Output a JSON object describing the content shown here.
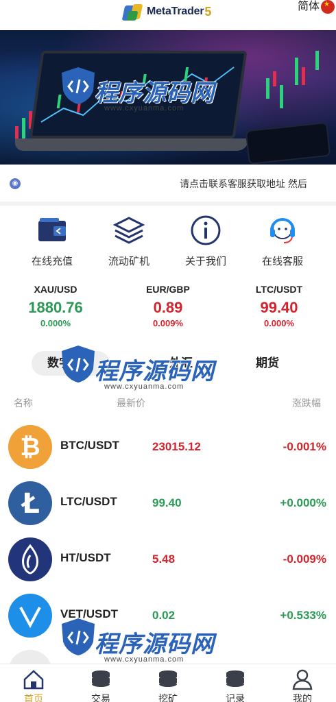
{
  "header": {
    "logo_text": "MetaTrader",
    "logo_version": "5",
    "language": "简体"
  },
  "notice": {
    "text": "请点击联系客服获取地址 然后"
  },
  "quick_actions": [
    {
      "label": "在线充值",
      "icon": "wallet-icon"
    },
    {
      "label": "流动矿机",
      "icon": "layers-icon"
    },
    {
      "label": "关于我们",
      "icon": "info-icon"
    },
    {
      "label": "在线客服",
      "icon": "headset-icon"
    }
  ],
  "tickers": [
    {
      "symbol": "XAU/USD",
      "price": "1880.76",
      "change": "0.000%",
      "color": "#2b9a55"
    },
    {
      "symbol": "EUR/GBP",
      "price": "0.89",
      "change": "0.009%",
      "color": "#d3232d"
    },
    {
      "symbol": "LTC/USDT",
      "price": "99.40",
      "change": "0.000%",
      "color": "#d3232d"
    }
  ],
  "tabs": [
    {
      "label": "数字货币",
      "active": true
    },
    {
      "label": "外汇",
      "active": false
    },
    {
      "label": "期货",
      "active": false
    }
  ],
  "table": {
    "headers": {
      "name": "名称",
      "price": "最新价",
      "change": "涨跌幅"
    },
    "rows": [
      {
        "pair": "BTC/USDT",
        "price": "23015.12",
        "change": "-0.001%",
        "price_color": "#d3232d",
        "change_color": "#d3232d",
        "icon": "bitcoin-icon",
        "icon_color": "#f0a137"
      },
      {
        "pair": "LTC/USDT",
        "price": "99.40",
        "change": "+0.000%",
        "price_color": "#2b9a55",
        "change_color": "#2b9a55",
        "icon": "litecoin-icon",
        "icon_color": "#2f5f9e"
      },
      {
        "pair": "HT/USDT",
        "price": "5.48",
        "change": "-0.009%",
        "price_color": "#d3232d",
        "change_color": "#d3232d",
        "icon": "huobi-token-icon",
        "icon_color": "#23357a"
      },
      {
        "pair": "VET/USDT",
        "price": "0.02",
        "change": "+0.533%",
        "price_color": "#2b9a55",
        "change_color": "#2b9a55",
        "icon": "vechain-icon",
        "icon_color": "#1d8fe8"
      }
    ]
  },
  "bottom_nav": [
    {
      "label": "首页",
      "icon": "home-icon",
      "active": true
    },
    {
      "label": "交易",
      "icon": "coins-stack-icon",
      "active": false
    },
    {
      "label": "挖矿",
      "icon": "mining-icon",
      "active": false
    },
    {
      "label": "记录",
      "icon": "records-icon",
      "active": false
    },
    {
      "label": "我的",
      "icon": "user-icon",
      "active": false
    }
  ],
  "watermark": {
    "text": "程序源码网",
    "url": "www.cxyuanma.com"
  },
  "colors": {
    "up_green": "#2b9a55",
    "down_red": "#d3232d",
    "accent_gold": "#d6a225",
    "brand_blue": "#1d2a55"
  }
}
